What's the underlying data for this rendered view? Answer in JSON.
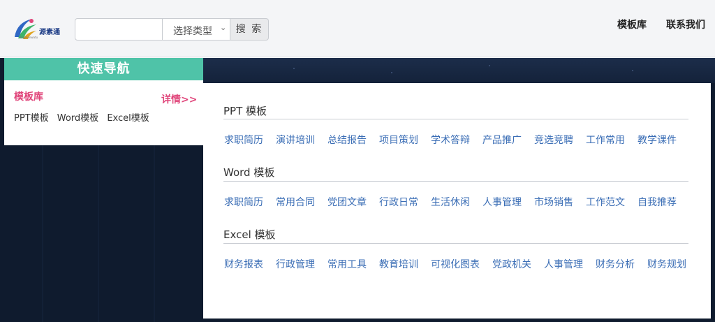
{
  "header": {
    "logo_text": "源素通",
    "logo_subtext": "Angelenwatu",
    "search_placeholder": "",
    "type_select_value": "选择类型",
    "search_button": "搜 索",
    "nav": [
      "模板库",
      "联系我们"
    ]
  },
  "quick_nav": {
    "title": "快速导航",
    "library_label": "模板库",
    "more_label": "详情>>",
    "links": [
      "PPT模板",
      "Word模板",
      "Excel模板"
    ]
  },
  "panel": {
    "sections": [
      {
        "title": "PPT 模板",
        "links": [
          "求职简历",
          "演讲培训",
          "总结报告",
          "项目策划",
          "学术答辩",
          "产品推广",
          "竞选竞聘",
          "工作常用",
          "教学课件"
        ]
      },
      {
        "title": "Word 模板",
        "links": [
          "求职简历",
          "常用合同",
          "党团文章",
          "行政日常",
          "生活休闲",
          "人事管理",
          "市场销售",
          "工作范文",
          "自我推荐"
        ]
      },
      {
        "title": "Excel 模板",
        "links": [
          "财务报表",
          "行政管理",
          "常用工具",
          "教育培训",
          "可视化图表",
          "党政机关",
          "人事管理",
          "财务分析",
          "财务规划"
        ]
      }
    ]
  },
  "colors": {
    "accent_teal": "#4fc3a8",
    "accent_pink": "#e0457a",
    "link_blue": "#3a6db5",
    "banner_navy": "#0f1b2e"
  }
}
